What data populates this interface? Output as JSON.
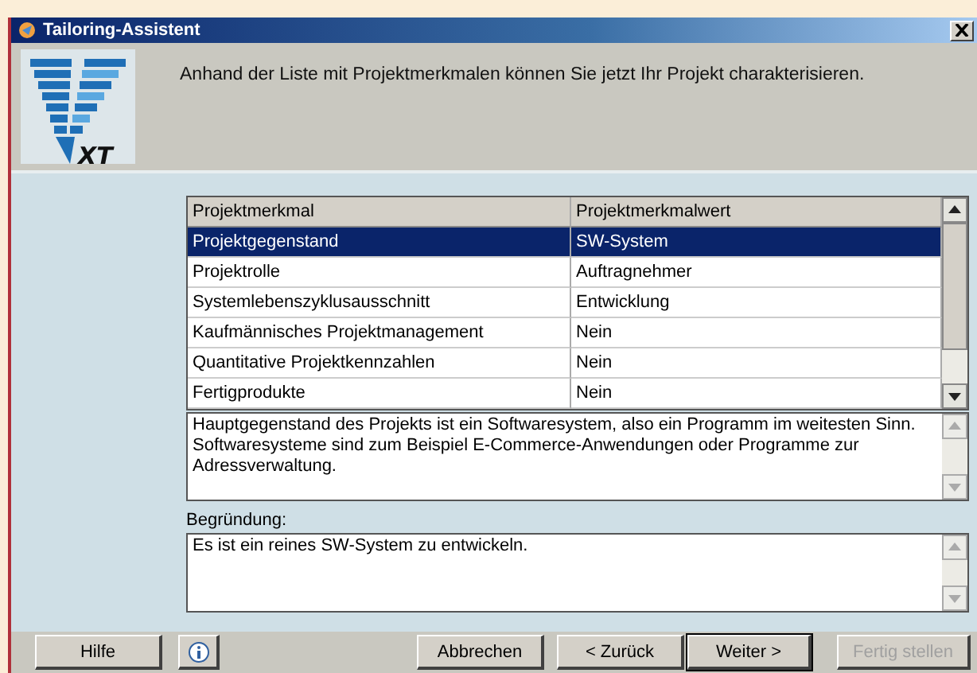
{
  "window": {
    "title": "Tailoring-Assistent"
  },
  "header": {
    "text": "Anhand der Liste mit Projektmerkmalen können Sie jetzt Ihr Projekt charakterisieren.",
    "logo_text": "XT"
  },
  "table": {
    "columns": [
      "Projektmerkmal",
      "Projektmerkmalwert"
    ],
    "rows": [
      {
        "cells": [
          "Projektgegenstand",
          "SW-System"
        ],
        "selected": true
      },
      {
        "cells": [
          "Projektrolle",
          "Auftragnehmer"
        ],
        "selected": false
      },
      {
        "cells": [
          "Systemlebenszyklusausschnitt",
          "Entwicklung"
        ],
        "selected": false
      },
      {
        "cells": [
          "Kaufmännisches Projektmanagement",
          "Nein"
        ],
        "selected": false
      },
      {
        "cells": [
          "Quantitative Projektkennzahlen",
          "Nein"
        ],
        "selected": false
      },
      {
        "cells": [
          "Fertigprodukte",
          "Nein"
        ],
        "selected": false
      }
    ]
  },
  "description": {
    "text": "Hauptgegenstand des Projekts ist ein Softwaresystem, also ein Programm im weitesten Sinn. Softwaresysteme sind zum Beispiel E-Commerce-Anwendungen oder Programme zur Adressverwaltung."
  },
  "reason": {
    "label": "Begründung:",
    "value": "Es ist ein reines SW-System zu entwickeln."
  },
  "buttons": [
    {
      "kind": "text",
      "label": "Hilfe",
      "disabled": false,
      "default": false
    },
    {
      "kind": "info",
      "disabled": false,
      "default": false
    },
    {
      "kind": "text",
      "label": "Abbrechen",
      "disabled": false,
      "default": false
    },
    {
      "kind": "text",
      "label": "< Zurück",
      "disabled": false,
      "default": false
    },
    {
      "kind": "text",
      "label": "Weiter >",
      "disabled": false,
      "default": true
    },
    {
      "kind": "text",
      "label": "Fertig stellen",
      "disabled": true,
      "default": false
    }
  ]
}
